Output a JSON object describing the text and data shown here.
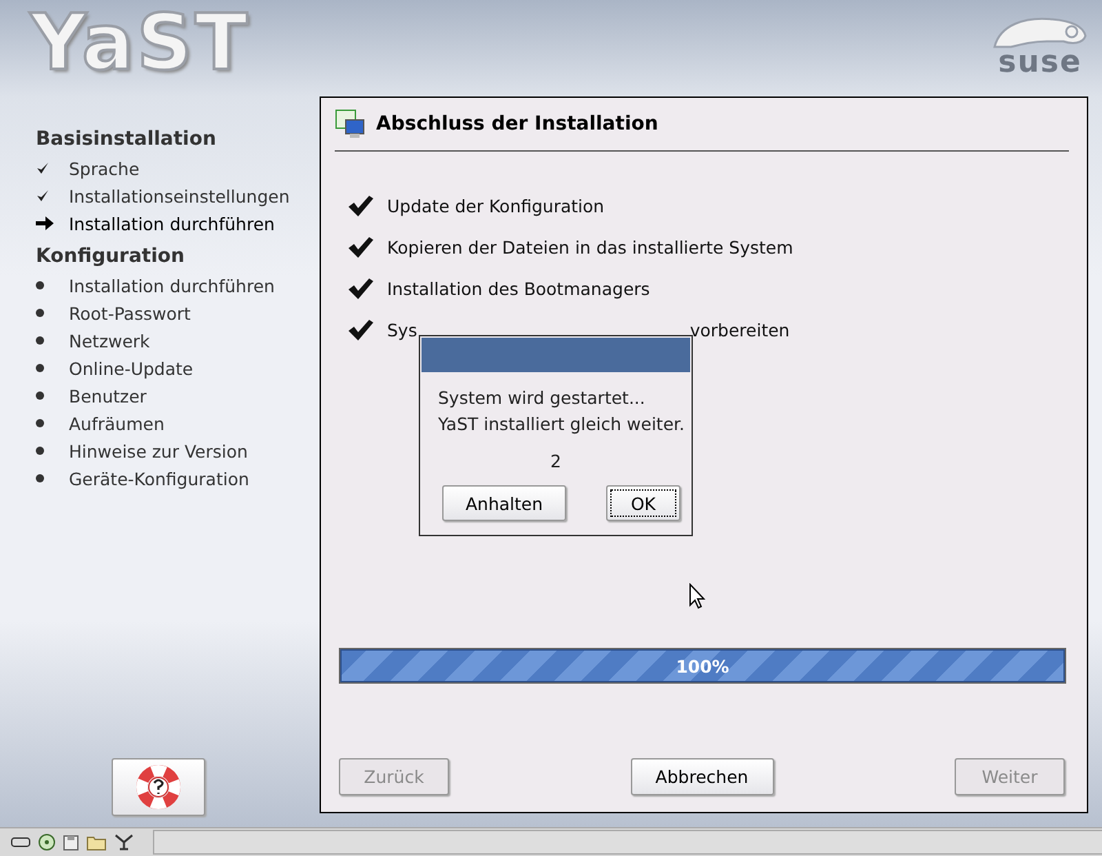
{
  "header": {
    "logo": "YaST",
    "brand": "suse"
  },
  "sidebar": {
    "sections": [
      {
        "title": "Basisinstallation",
        "items": [
          {
            "label": "Sprache",
            "kind": "done"
          },
          {
            "label": "Installationseinstellungen",
            "kind": "done"
          },
          {
            "label": "Installation durchführen",
            "kind": "current"
          }
        ]
      },
      {
        "title": "Konfiguration",
        "items": [
          {
            "label": "Installation durchführen",
            "kind": "pending"
          },
          {
            "label": "Root-Passwort",
            "kind": "pending"
          },
          {
            "label": "Netzwerk",
            "kind": "pending"
          },
          {
            "label": "Online-Update",
            "kind": "pending"
          },
          {
            "label": "Benutzer",
            "kind": "pending"
          },
          {
            "label": "Aufräumen",
            "kind": "pending"
          },
          {
            "label": "Hinweise zur Version",
            "kind": "pending"
          },
          {
            "label": "Geräte-Konfiguration",
            "kind": "pending"
          }
        ]
      }
    ]
  },
  "panel": {
    "title": "Abschluss der Installation",
    "steps": [
      {
        "label": "Update der Konfiguration",
        "done": true
      },
      {
        "label": "Kopieren der Dateien in das installierte System",
        "done": true
      },
      {
        "label": "Installation des Bootmanagers",
        "done": true
      },
      {
        "label": "Sys",
        "rest": "vorbereiten",
        "done": true
      }
    ],
    "progress": {
      "level": 1,
      "text": "100%"
    },
    "buttons": [
      {
        "label": "Zurück",
        "disabled": true
      },
      {
        "label": "Abbrechen",
        "disabled": false
      },
      {
        "label": "Weiter",
        "disabled": true
      }
    ]
  },
  "dialog": {
    "lines": [
      "System wird gestartet...",
      "YaST installiert gleich weiter."
    ],
    "countdown": "2",
    "buttons": [
      {
        "label": "Anhalten",
        "focused": false
      },
      {
        "label": "OK",
        "focused": true
      }
    ]
  }
}
